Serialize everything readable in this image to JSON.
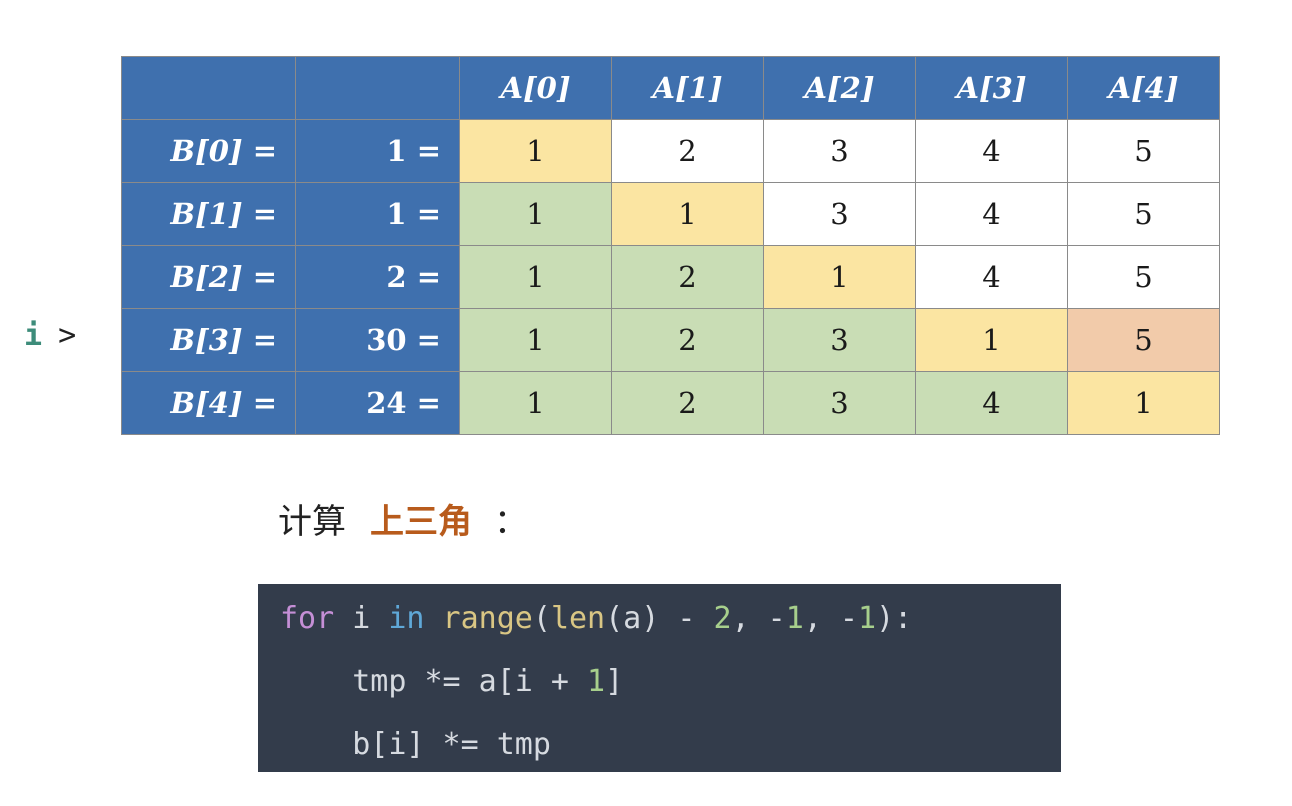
{
  "pointer": {
    "variable": "i",
    "arrow": ">"
  },
  "table": {
    "column_headers": [
      "A[0]",
      "A[1]",
      "A[2]",
      "A[3]",
      "A[4]"
    ],
    "rows": [
      {
        "label": "B[0] =",
        "value": "1 =",
        "cells": [
          "1",
          "2",
          "3",
          "4",
          "5"
        ],
        "colors": [
          "yellow",
          "white",
          "white",
          "white",
          "white"
        ]
      },
      {
        "label": "B[1] =",
        "value": "1 =",
        "cells": [
          "1",
          "1",
          "3",
          "4",
          "5"
        ],
        "colors": [
          "green",
          "yellow",
          "white",
          "white",
          "white"
        ]
      },
      {
        "label": "B[2] =",
        "value": "2 =",
        "cells": [
          "1",
          "2",
          "1",
          "4",
          "5"
        ],
        "colors": [
          "green",
          "green",
          "yellow",
          "white",
          "white"
        ]
      },
      {
        "label": "B[3] =",
        "value": "30 =",
        "cells": [
          "1",
          "2",
          "3",
          "1",
          "5"
        ],
        "colors": [
          "green",
          "green",
          "green",
          "yellow",
          "orange"
        ]
      },
      {
        "label": "B[4] =",
        "value": "24 =",
        "cells": [
          "1",
          "2",
          "3",
          "4",
          "1"
        ],
        "colors": [
          "green",
          "green",
          "green",
          "green",
          "yellow"
        ]
      }
    ],
    "pointer_row": 3
  },
  "caption": {
    "prefix": "计算",
    "highlight": "上三角",
    "suffix": "："
  },
  "code": {
    "line1": {
      "kw_for": "for",
      "var_i": " i ",
      "kw_in": "in",
      "fn_range": " range",
      "p1": "(",
      "fn_len": "len",
      "p2": "(a) - ",
      "n2": "2",
      "p3": ", -",
      "n3": "1",
      "p4": ", -",
      "n4": "1",
      "p5": "):"
    },
    "line2": {
      "text": "    tmp *= a[i + ",
      "num": "1",
      "end": "]"
    },
    "line3": {
      "text": "    b[i] *= tmp"
    }
  },
  "colors": {
    "header": "#3f70ae",
    "yellow": "#fbe5a2",
    "green": "#c9ddb5",
    "orange": "#f2cbaa",
    "white": "#ffffff",
    "code_bg": "#333c4b",
    "caption_highlight": "#b85b1c",
    "pointer": "#3d8c7a"
  }
}
